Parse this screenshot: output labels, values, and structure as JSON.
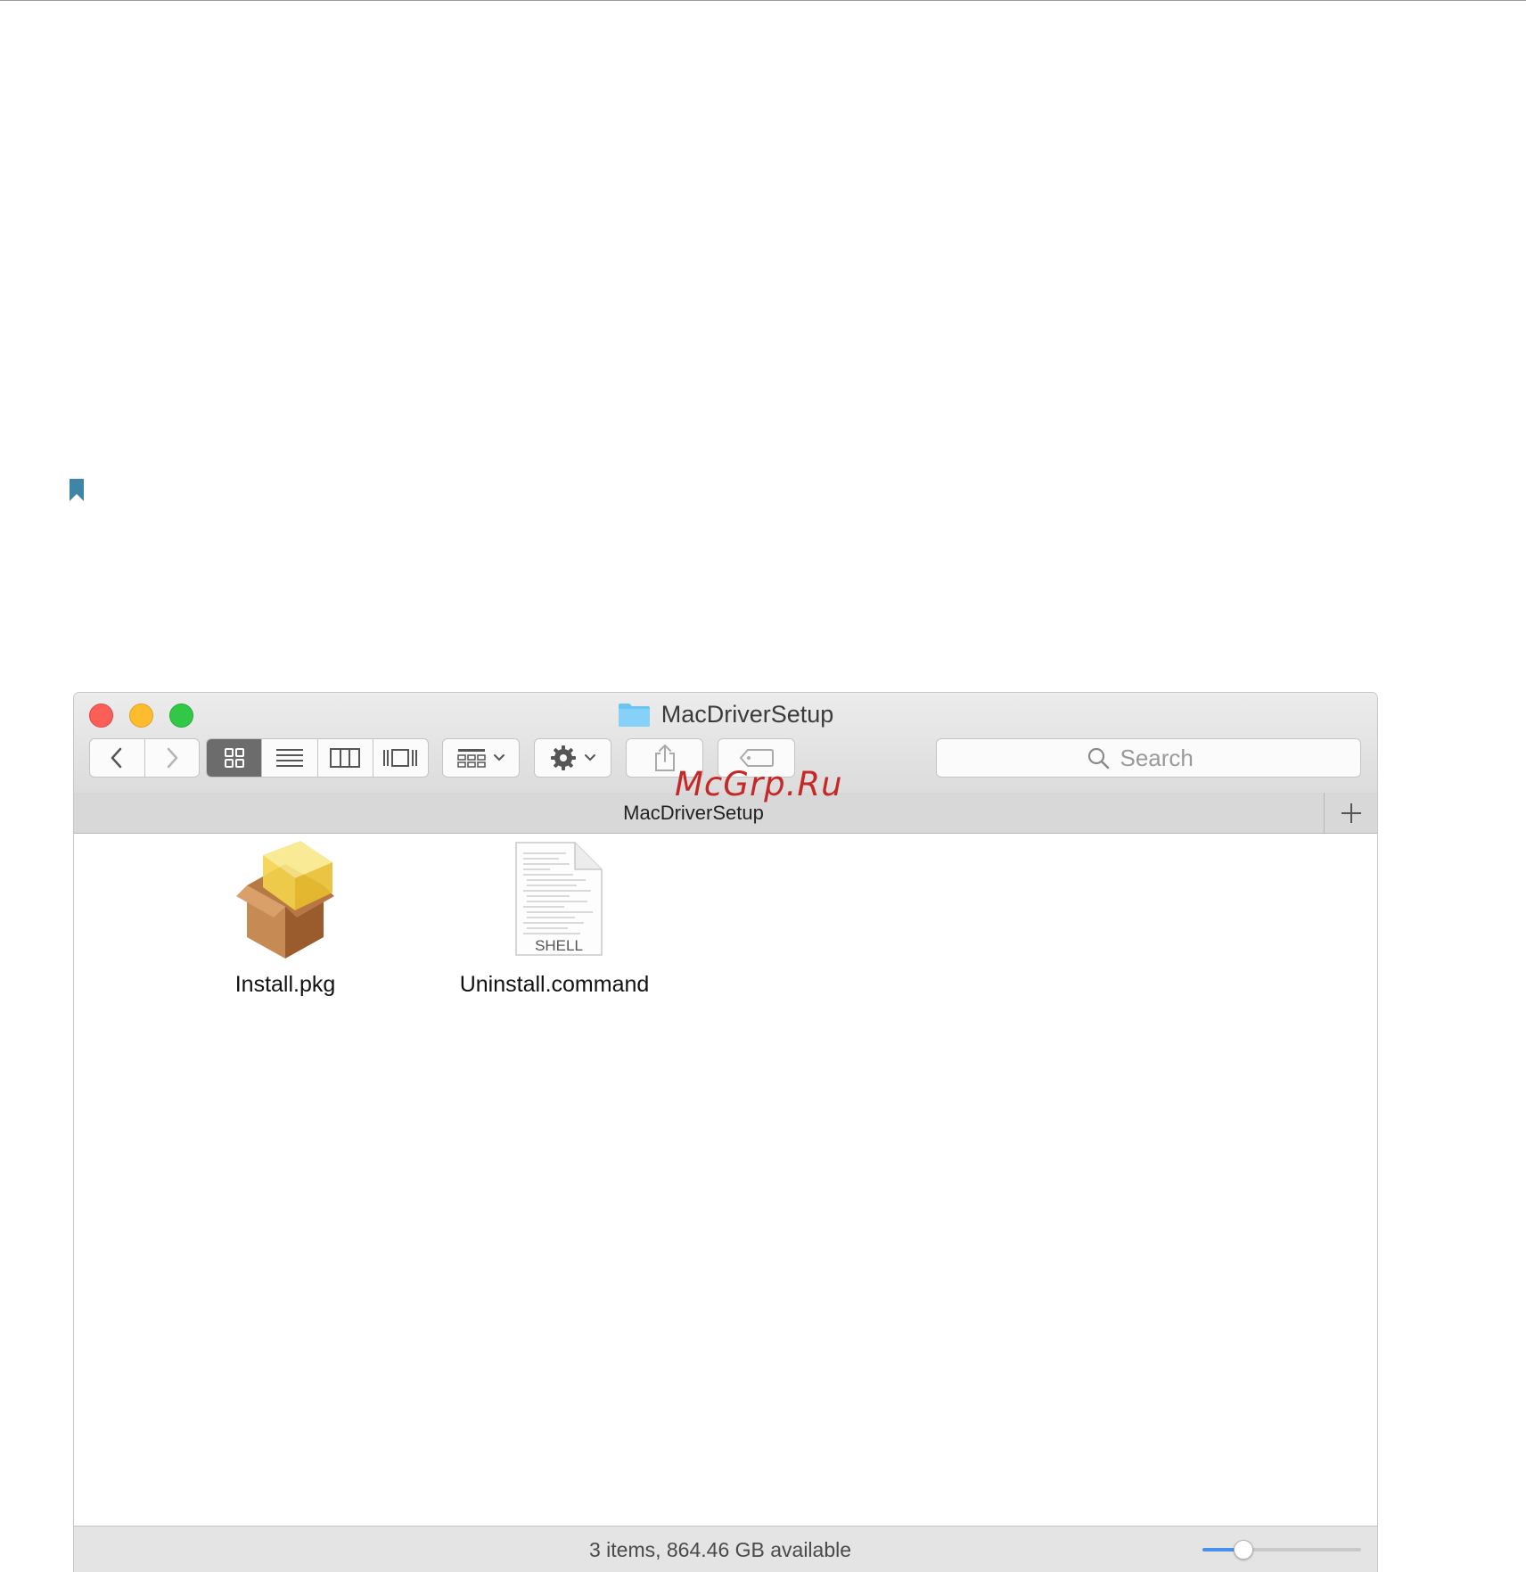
{
  "window": {
    "title": "MacDriverSetup",
    "tab_title": "MacDriverSetup"
  },
  "toolbar": {
    "back_icon": "chevron-left-icon",
    "forward_icon": "chevron-right-icon",
    "view_modes": [
      "icon-view",
      "list-view",
      "column-view",
      "cover-flow-view"
    ],
    "active_view": "icon-view",
    "arrange_icon": "arrange-grid-icon",
    "action_icon": "gear-icon",
    "share_icon": "share-icon",
    "tag_icon": "tag-icon"
  },
  "search": {
    "placeholder": "Search"
  },
  "files": [
    {
      "name": "Install.pkg",
      "icon": "package-icon"
    },
    {
      "name": "Uninstall.command",
      "icon": "shell-script-icon",
      "icon_label": "SHELL"
    }
  ],
  "status": {
    "text": "3 items, 864.46 GB available",
    "zoom_level": 0.26
  },
  "watermark": "McGrp.Ru",
  "colors": {
    "close": "#fc5f57",
    "minimize": "#fdbc2e",
    "maximize": "#33c748",
    "slider_accent": "#4a90ea",
    "watermark": "#c62828",
    "bookmark": "#3f86a6"
  }
}
